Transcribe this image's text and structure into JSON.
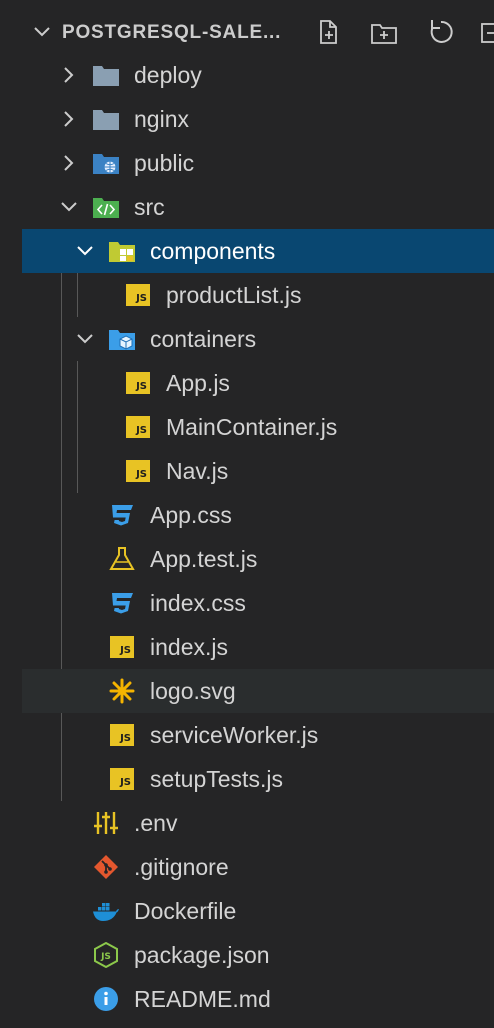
{
  "explorer": {
    "section_title": "POSTGRESQL-SALE...",
    "toolbar": {
      "new_file_icon": "new-file-icon",
      "new_folder_icon": "new-folder-icon",
      "refresh_icon": "refresh-icon",
      "collapse_icon": "collapse-all-icon"
    }
  },
  "tree": {
    "items": [
      {
        "label": "deploy",
        "type": "folder",
        "expanded": false
      },
      {
        "label": "nginx",
        "type": "folder",
        "expanded": false
      },
      {
        "label": "public",
        "type": "folder",
        "expanded": false
      },
      {
        "label": "src",
        "type": "folder",
        "expanded": true
      },
      {
        "label": "components",
        "type": "folder",
        "expanded": true,
        "selected": true
      },
      {
        "label": "productList.js",
        "type": "js"
      },
      {
        "label": "containers",
        "type": "folder",
        "expanded": true
      },
      {
        "label": "App.js",
        "type": "js"
      },
      {
        "label": "MainContainer.js",
        "type": "js"
      },
      {
        "label": "Nav.js",
        "type": "js"
      },
      {
        "label": "App.css",
        "type": "css"
      },
      {
        "label": "App.test.js",
        "type": "test"
      },
      {
        "label": "index.css",
        "type": "css"
      },
      {
        "label": "index.js",
        "type": "js"
      },
      {
        "label": "logo.svg",
        "type": "svg",
        "hovered": true
      },
      {
        "label": "serviceWorker.js",
        "type": "js"
      },
      {
        "label": "setupTests.js",
        "type": "js"
      },
      {
        "label": ".env",
        "type": "env"
      },
      {
        "label": ".gitignore",
        "type": "git"
      },
      {
        "label": "Dockerfile",
        "type": "docker"
      },
      {
        "label": "package.json",
        "type": "node"
      },
      {
        "label": "README.md",
        "type": "info"
      }
    ]
  },
  "colors": {
    "background": "#252526",
    "selected_row": "#094771",
    "hover_row": "#2a2d2e",
    "js_badge": "#e8c324",
    "css_icon": "#3b9ee8",
    "folder_gray": "#8a9fb2",
    "git": "#e4572e",
    "docker": "#1e8fd6",
    "node": "#8cc84b",
    "info": "#3b9ee8"
  },
  "js_badge_text": "JS"
}
